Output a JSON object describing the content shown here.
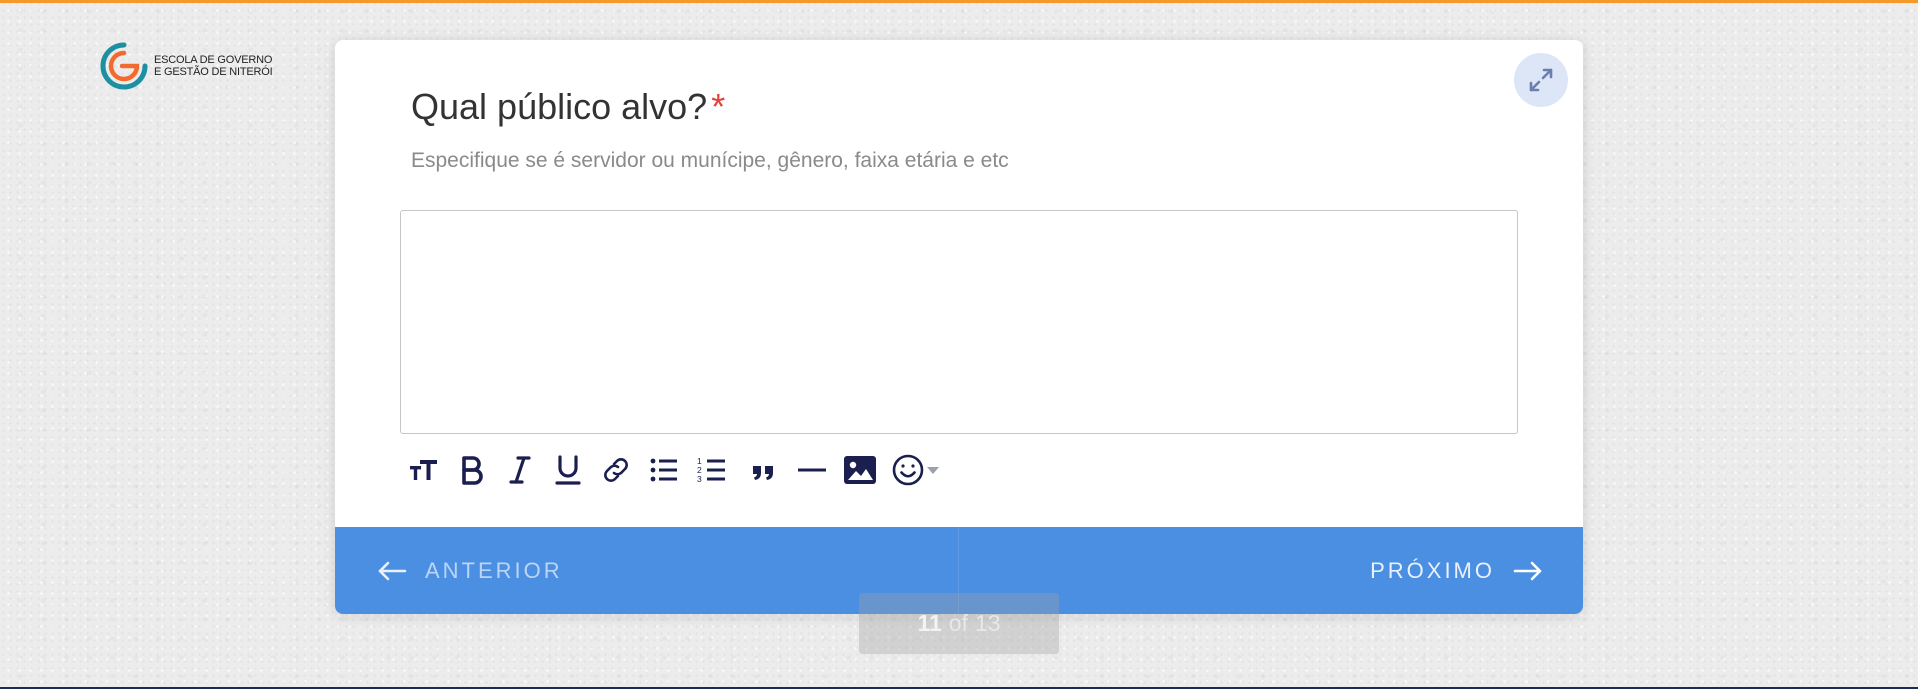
{
  "logo": {
    "line1": "Escola de Governo",
    "line2": "e Gestão de Niterói"
  },
  "question": {
    "title": "Qual público alvo?",
    "required_mark": "*",
    "description": "Especifique se é servidor ou munícipe, gênero, faixa etária e etc"
  },
  "editor": {
    "value": ""
  },
  "toolbar": {
    "tools": [
      {
        "icon": "text-size-icon"
      },
      {
        "icon": "bold-icon"
      },
      {
        "icon": "italic-icon"
      },
      {
        "icon": "underline-icon"
      },
      {
        "icon": "link-icon"
      },
      {
        "icon": "bulleted-list-icon"
      },
      {
        "icon": "numbered-list-icon"
      },
      {
        "icon": "quote-icon"
      },
      {
        "icon": "horizontal-rule-icon"
      },
      {
        "icon": "image-icon"
      },
      {
        "icon": "emoji-icon"
      }
    ]
  },
  "nav": {
    "prev_label": "ANTERIOR",
    "next_label": "PRÓXIMO"
  },
  "pagination": {
    "current": "11",
    "of": "of",
    "total": "13"
  },
  "colors": {
    "accent": "#4a8fe2",
    "required": "#e0433a",
    "top_strip": "#f59a2a",
    "bottom_strip": "#1c2a5a",
    "toolbar_icon": "#1a1f4f",
    "logo_teal": "#1c8fa0",
    "logo_orange": "#f26a2e"
  }
}
